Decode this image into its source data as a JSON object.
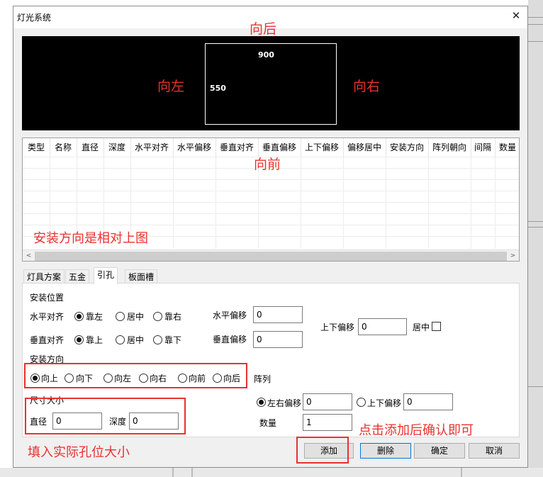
{
  "window": {
    "title": "灯光系统",
    "close_icon": "close-icon"
  },
  "preview": {
    "dim_width": "900",
    "dim_height": "550",
    "label_back": "向后",
    "label_left": "向左",
    "label_right": "向右",
    "label_front": "向前"
  },
  "grid": {
    "columns": [
      "类型",
      "名称",
      "直径",
      "深度",
      "水平对齐",
      "水平偏移",
      "垂直对齐",
      "垂直偏移",
      "上下偏移",
      "偏移居中",
      "安装方向",
      "阵列朝向",
      "间隔",
      "数量"
    ],
    "rows": [],
    "annotation": "安装方向是相对上图",
    "scroll_left": "<",
    "scroll_right": ">"
  },
  "tabs": [
    {
      "label": "灯具方案",
      "active": false
    },
    {
      "label": "五金",
      "active": false
    },
    {
      "label": "引孔",
      "active": true
    },
    {
      "label": "板面槽",
      "active": false
    }
  ],
  "form": {
    "install_position_title": "安装位置",
    "h_align_label": "水平对齐",
    "h_align_options": [
      "靠左",
      "居中",
      "靠右"
    ],
    "h_align_selected": "靠左",
    "h_offset_label": "水平偏移",
    "h_offset_value": "0",
    "v_align_label": "垂直对齐",
    "v_align_options": [
      "靠上",
      "居中",
      "靠下"
    ],
    "v_align_selected": "靠上",
    "v_offset_label": "垂直偏移",
    "v_offset_value": "0",
    "ud_offset_label": "上下偏移",
    "ud_offset_value": "0",
    "center_label": "居中",
    "center_checked": false,
    "direction_title": "安装方向",
    "direction_options": [
      "向上",
      "向下",
      "向左",
      "向右",
      "向前",
      "向后"
    ],
    "direction_selected": "向上",
    "array_label": "阵列",
    "size_title": "尺寸大小",
    "diameter_label": "直径",
    "diameter_value": "0",
    "depth_label": "深度",
    "depth_value": "0",
    "lr_offset_label": "左右偏移",
    "lr_offset_value": "0",
    "lr_selected": true,
    "ud2_offset_label": "上下偏移",
    "ud2_offset_value": "0",
    "ud2_selected": false,
    "count_label": "数量",
    "count_value": "1"
  },
  "annotations": {
    "fill_size": "填入实际孔位大小",
    "click_add": "点击添加后确认即可",
    "color": "#e8322f"
  },
  "buttons": {
    "add": "添加",
    "delete": "删除",
    "ok": "确定",
    "cancel": "取消"
  }
}
